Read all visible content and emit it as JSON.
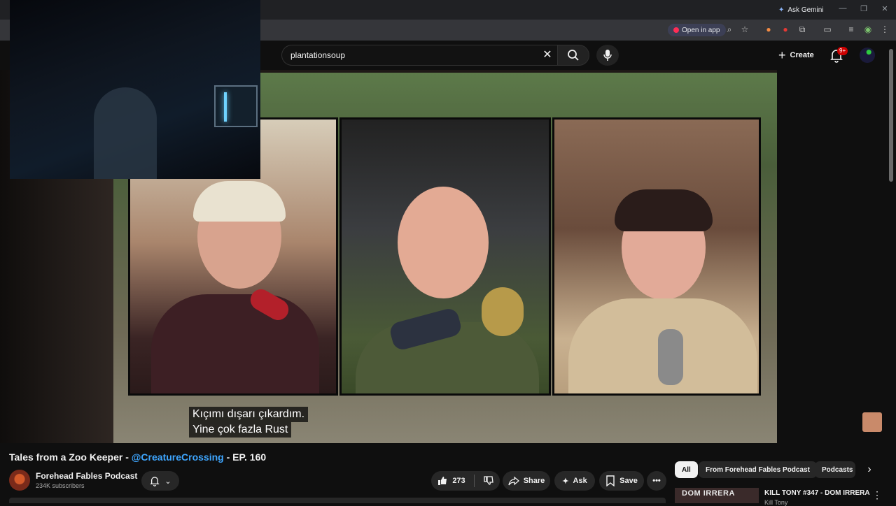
{
  "browser": {
    "ask_gemini_label": "Ask Gemini",
    "open_in_app_label": "Open in app"
  },
  "header": {
    "search_value": "plantationsoup",
    "create_label": "Create",
    "notification_badge": "9+"
  },
  "player": {
    "subtitle_line1": "Kıçımı dışarı çıkardım.",
    "subtitle_line2": "Yine çok fazla Rust"
  },
  "video": {
    "title_prefix": "Tales from a Zoo Keeper - ",
    "title_mention": "@CreatureCrossing",
    "title_suffix": " - EP. 160",
    "channel_name": "Forehead Fables Podcast",
    "subscribers": "234K subscribers",
    "like_count": "273",
    "share_label": "Share",
    "ask_label": "Ask",
    "save_label": "Save"
  },
  "chips": [
    {
      "label": "All",
      "active": true
    },
    {
      "label": "From Forehead Fables Podcast",
      "active": false
    },
    {
      "label": "Podcasts",
      "active": false
    }
  ],
  "recommendation": {
    "thumb_text": "DOM IRRERA",
    "title": "KILL TONY #347 - DOM IRRERA",
    "channel": "Kill Tony"
  }
}
